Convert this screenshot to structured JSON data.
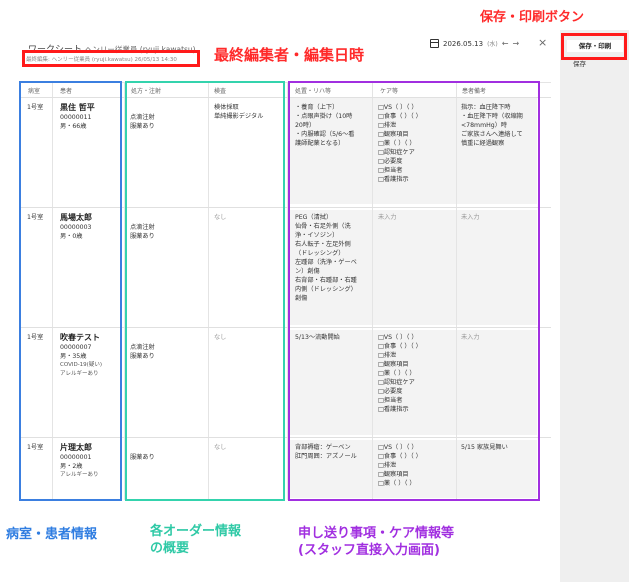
{
  "annotations": {
    "save_print_button": "保存・印刷ボタン",
    "last_editor": "最終編集者・編集日時",
    "room_patient_info": "病室・患者情報",
    "orders_summary_line1": "各オーダー情報",
    "orders_summary_line2": "の概要",
    "handover_line1": "申し送り事項・ケア情報等",
    "handover_line2": "(スタッフ直接入力画面)"
  },
  "header": {
    "title": "ワークシート",
    "title_sub": "ヘンリー従業員 (ryuji.kawatsu)",
    "meta": "最終編集: ヘンリー従業員 (ryuji.kawatsu) 26/05/13 14:30",
    "date": "2026.05.13",
    "day_of_week": "(水)",
    "prev_icon": "←",
    "next_icon": "→",
    "close_icon": "×"
  },
  "side_panel": {
    "save_print_label": "保存・印刷",
    "save_label": "保存"
  },
  "columns": [
    "病室",
    "患者",
    "処方・注射",
    "検査",
    "処置・リハ等",
    "ケア等",
    "患者備考"
  ],
  "rows": [
    {
      "room": "1号室",
      "name": "黒住 哲平",
      "id": "00000011",
      "sex_age": "男・66歳",
      "notes_small": [
        "",
        ""
      ],
      "orders": [
        "点滴注射",
        "服薬あり"
      ],
      "exams": [
        "検体採取",
        "単純撮影デジタル"
      ],
      "procedures": [
        "・養育（上下）",
        "・点眼声掛け（10時",
        "20時）",
        "・内服確認（5/6〜看",
        "護師配薬となる）"
      ],
      "care": [
        "□VS（ ）（ ）",
        "□食事（ ）（ ）",
        "□排泄",
        "□観察項目",
        "□薬（ ）（ ）",
        "□認知症ケア",
        "□必要度",
        "□担当者",
        "□看護指示"
      ],
      "remarks": [
        "指示：血圧降下時",
        "・血圧降下時（収縮期",
        "<78mmHg）時",
        "ご家族さんへ連絡して",
        "慎重に経過観察"
      ]
    },
    {
      "room": "1号室",
      "name": "馬場太郎",
      "id": "00000003",
      "sex_age": "男・0歳",
      "notes_small": [
        "",
        ""
      ],
      "orders": [
        "点滴注射",
        "服薬あり"
      ],
      "exams": [
        "なし"
      ],
      "procedures": [
        "PEG（清拭）",
        "仙骨・右足外側（洗",
        "浄・イソジン）",
        "右人転子・左足外側",
        "（ドレッシング）",
        "左踵部（洗浄・ゲーベ",
        "ン）創傷",
        "右背部・右踵部・右踵",
        "内側（ドレッシング）",
        "創傷"
      ],
      "care": [
        "未入力"
      ],
      "remarks": [
        "未入力"
      ]
    },
    {
      "room": "1号室",
      "name": "吹春テスト",
      "id": "00000007",
      "sex_age": "男・35歳",
      "notes_small": [
        "COVID-19(疑い)",
        "アレルギーあり"
      ],
      "orders": [
        "点滴注射",
        "服薬あり"
      ],
      "exams": [
        "なし"
      ],
      "procedures": [
        "5/13〜流動開始"
      ],
      "care": [
        "□VS（ ）（ ）",
        "□食事（ ）（ ）",
        "□排泄",
        "□観察項目",
        "□薬（ ）（ ）",
        "□認知症ケア",
        "□必要度",
        "□担当者",
        "□看護指示"
      ],
      "remarks": [
        "未入力"
      ]
    },
    {
      "room": "1号室",
      "name": "片理太郎",
      "id": "00000001",
      "sex_age": "男・2歳",
      "notes_small": [
        "アレルギーあり",
        ""
      ],
      "orders": [
        "服薬あり"
      ],
      "exams": [
        "なし"
      ],
      "procedures": [
        "背部褥瘡：ゲーベン",
        "肛門周囲：アズノール"
      ],
      "care": [
        "□VS（ ）（ ）",
        "□食事（ ）（ ）",
        "□排泄",
        "□観察項目",
        "□薬（ ）（ ）"
      ],
      "remarks": [
        "5/15 家族見舞い"
      ]
    }
  ]
}
